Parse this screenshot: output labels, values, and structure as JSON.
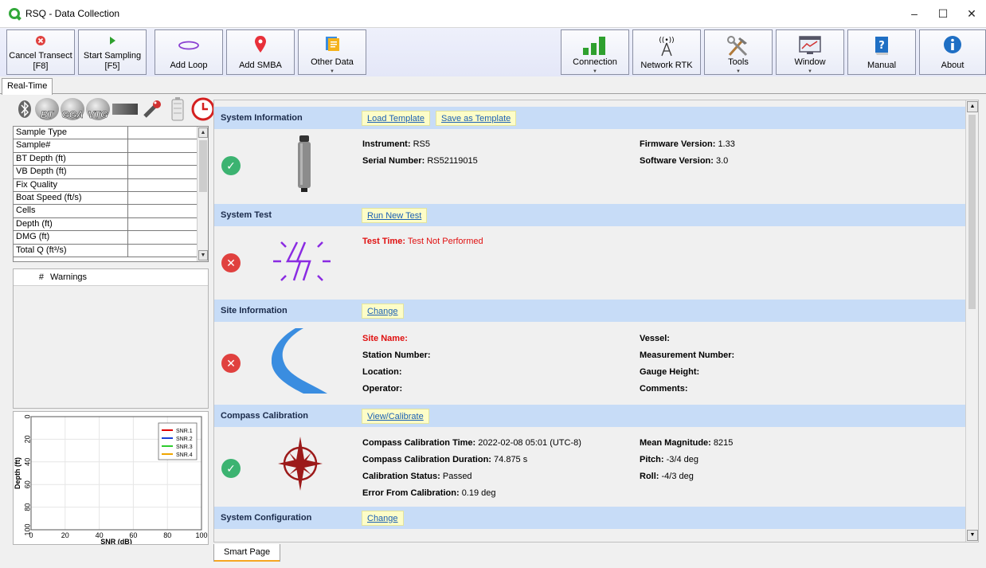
{
  "window": {
    "title": "RSQ - Data Collection",
    "controls": [
      "–",
      "☐",
      "✕"
    ]
  },
  "toolbar": {
    "cancel": {
      "label": "Cancel Transect",
      "shortcut": "[F8]"
    },
    "start": {
      "label": "Start Sampling",
      "shortcut": "[F5]"
    },
    "add_loop": "Add Loop",
    "add_smba": "Add SMBA",
    "other_data": "Other Data",
    "connection": "Connection",
    "network_rtk": "Network RTK",
    "tools": "Tools",
    "window": "Window",
    "manual": "Manual",
    "about": "About"
  },
  "tabs": {
    "realtime": "Real-Time",
    "smart_page": "Smart Page"
  },
  "status_icons": {
    "gps": [
      "BT",
      "GGA",
      "VTG"
    ]
  },
  "datagrid": {
    "rows": [
      "Sample Type",
      "Sample#",
      "BT Depth (ft)",
      "VB Depth (ft)",
      "Fix Quality",
      "Boat Speed (ft/s)",
      "Cells",
      "Depth (ft)",
      "DMG (ft)",
      "Total Q (ft³/s)"
    ]
  },
  "warnings": {
    "col_num": "#",
    "col_warn": "Warnings"
  },
  "chart_data": {
    "type": "line",
    "xlabel": "SNR (dB)",
    "ylabel": "Depth (ft)",
    "xlim": [
      0,
      100
    ],
    "ylim": [
      0,
      100
    ],
    "y_inverted": true,
    "xticks": [
      "0",
      "20",
      "40",
      "60",
      "80",
      "100"
    ],
    "yticks": [
      "0",
      "20",
      "40",
      "60",
      "80",
      "100"
    ],
    "legend_position": "top-right",
    "series": [
      {
        "name": "SNR.1",
        "color": "#e00000",
        "values": []
      },
      {
        "name": "SNR.2",
        "color": "#1a3fd6",
        "values": []
      },
      {
        "name": "SNR.3",
        "color": "#2ecc2e",
        "values": []
      },
      {
        "name": "SNR.4",
        "color": "#f0a500",
        "values": []
      }
    ]
  },
  "system_info": {
    "title": "System Information",
    "btn_load": "Load Template",
    "btn_save": "Save as Template",
    "instrument_label": "Instrument:",
    "instrument": "RS5",
    "serial_label": "Serial Number:",
    "serial": "RS52119015",
    "firmware_label": "Firmware Version:",
    "firmware": "1.33",
    "software_label": "Software Version:",
    "software": "3.0",
    "status": "ok"
  },
  "system_test": {
    "title": "System Test",
    "btn": "Run New Test",
    "time_label": "Test Time:",
    "time": "Test Not Performed",
    "status": "error"
  },
  "site_info": {
    "title": "Site Information",
    "btn": "Change",
    "site_name": "Site Name:",
    "station_number": "Station Number:",
    "location": "Location:",
    "operator": "Operator:",
    "vessel": "Vessel:",
    "measurement_number": "Measurement Number:",
    "gauge_height": "Gauge Height:",
    "comments": "Comments:",
    "status": "error"
  },
  "compass": {
    "title": "Compass Calibration",
    "btn": "View/Calibrate",
    "time_label": "Compass Calibration Time:",
    "time": "2022-02-08 05:01 (UTC-8)",
    "duration_label": "Compass Calibration Duration:",
    "duration": "74.875 s",
    "cal_status_label": "Calibration Status:",
    "cal_status": "Passed",
    "error_label": "Error From Calibration:",
    "error": "0.19 deg",
    "magnitude_label": "Mean Magnitude:",
    "magnitude": "8215",
    "pitch_label": "Pitch:",
    "pitch": "-3/4 deg",
    "roll_label": "Roll:",
    "roll": "-4/3 deg",
    "status": "ok"
  },
  "system_config": {
    "title": "System Configuration",
    "btn": "Change"
  },
  "colors": {
    "header_band": "#c7dcf7",
    "ok": "#3cb371",
    "error": "#e0413f",
    "link": "#1a5fb4"
  }
}
